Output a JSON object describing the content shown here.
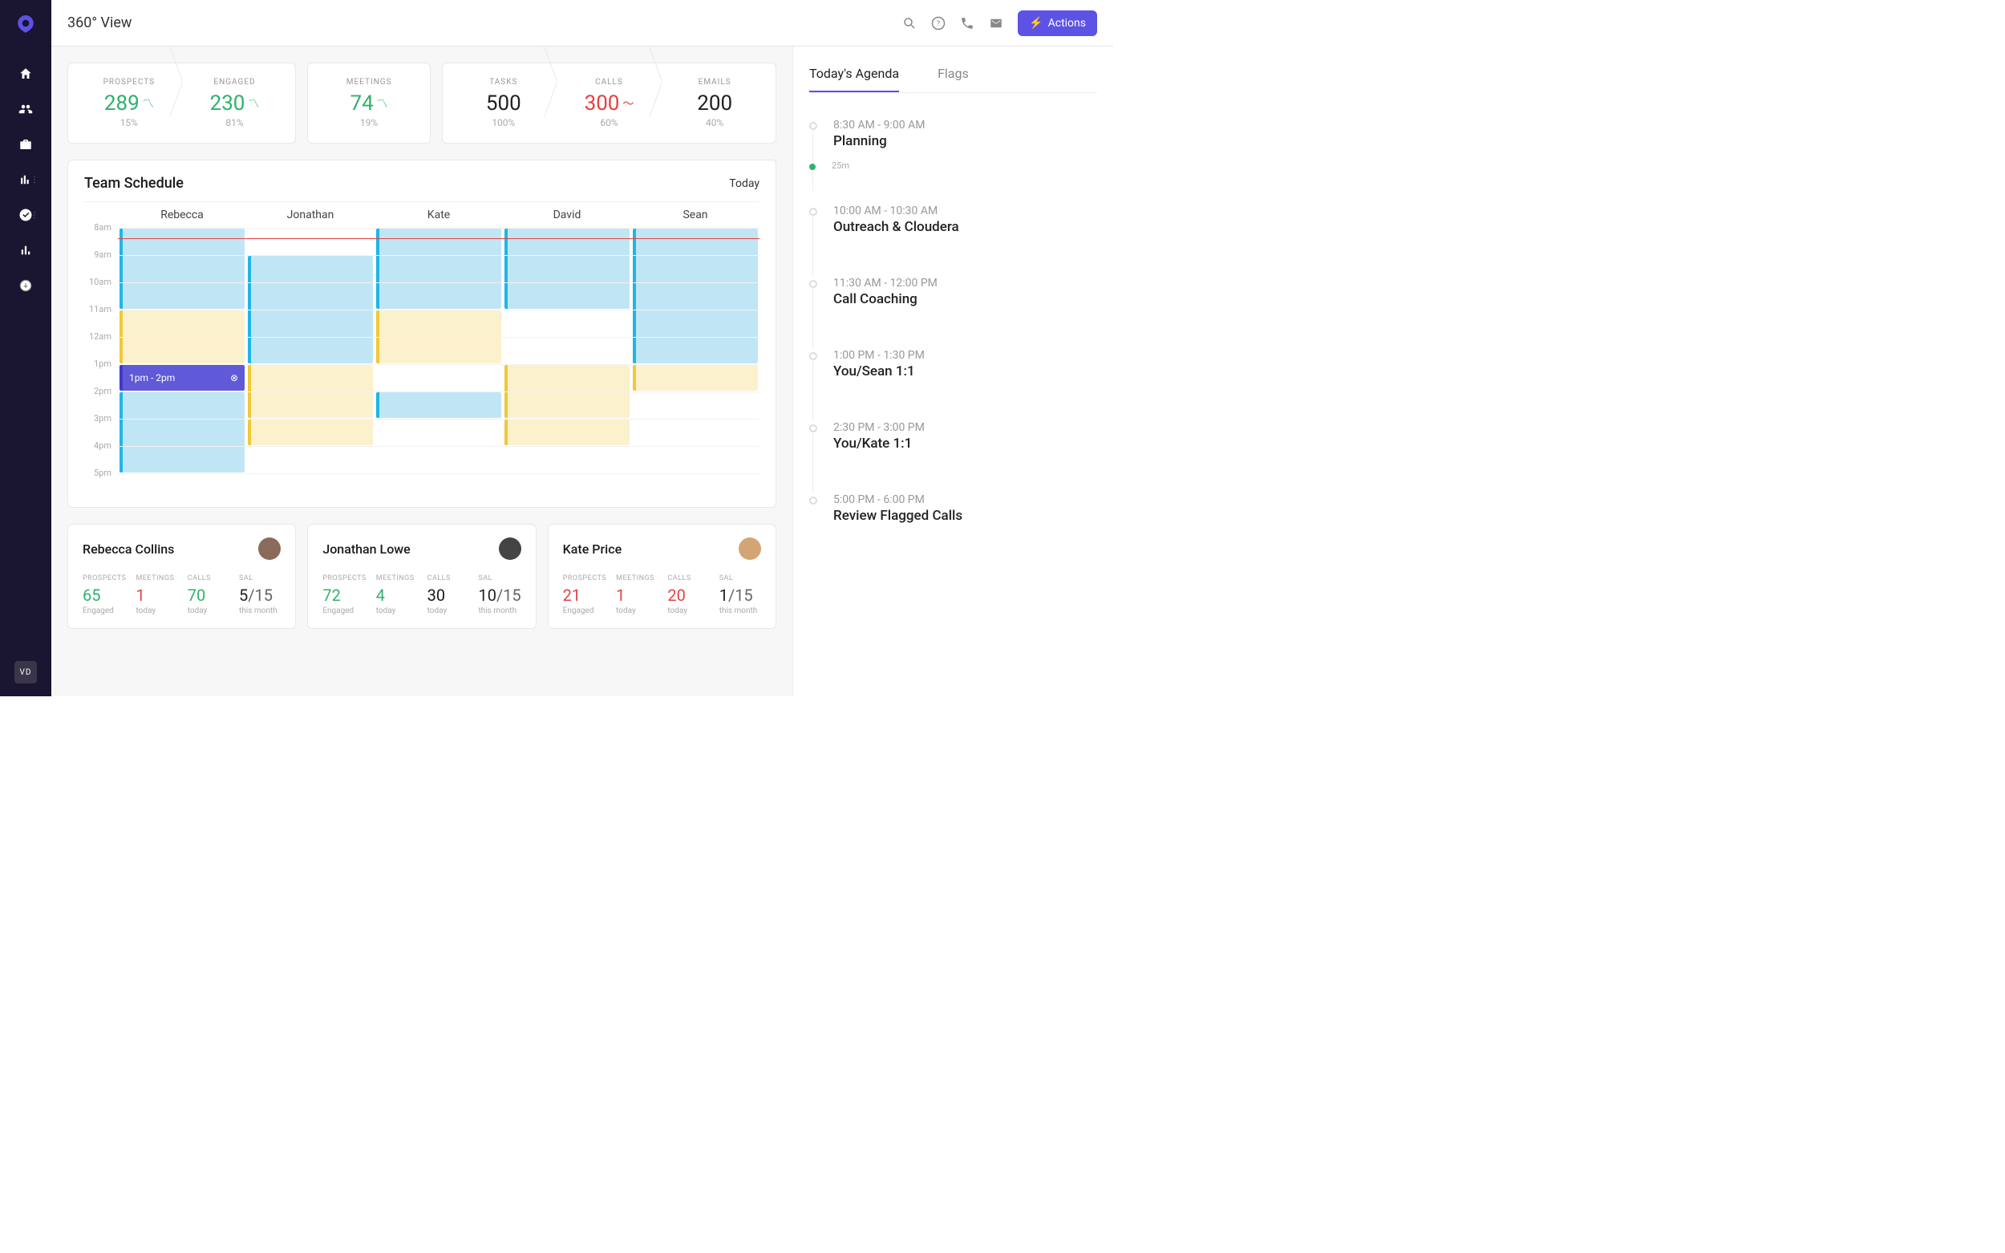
{
  "page_title": "360° View",
  "actions_label": "Actions",
  "sidebar": {
    "avatar_initials": "VD"
  },
  "stats": [
    {
      "label": "PROSPECTS",
      "value": "289",
      "pct": "15%",
      "trend": "up",
      "color": "green"
    },
    {
      "label": "ENGAGED",
      "value": "230",
      "pct": "81%",
      "trend": "up",
      "color": "green"
    },
    {
      "label": "MEETINGS",
      "value": "74",
      "pct": "19%",
      "trend": "up",
      "color": "green"
    },
    {
      "label": "TASKS",
      "value": "500",
      "pct": "100%",
      "trend": "",
      "color": ""
    },
    {
      "label": "CALLS",
      "value": "300",
      "pct": "60%",
      "trend": "down",
      "color": "red"
    },
    {
      "label": "EMAILS",
      "value": "200",
      "pct": "40%",
      "trend": "",
      "color": ""
    }
  ],
  "schedule": {
    "title": "Team Schedule",
    "today_label": "Today",
    "people": [
      "Rebecca",
      "Jonathan",
      "Kate",
      "David",
      "Sean"
    ],
    "hours": [
      "8am",
      "9am",
      "10am",
      "11am",
      "12am",
      "1pm",
      "2pm",
      "3pm",
      "4pm",
      "5pm"
    ],
    "highlight_label": "1pm - 2pm"
  },
  "agenda": {
    "tabs": [
      "Today's Agenda",
      "Flags"
    ],
    "now_label": "25m",
    "items": [
      {
        "time": "8:30 AM - 9:00 AM",
        "title": "Planning"
      },
      {
        "time": "10:00 AM - 10:30 AM",
        "title": "Outreach & Cloudera"
      },
      {
        "time": "11:30 AM - 12:00 PM",
        "title": "Call Coaching"
      },
      {
        "time": "1:00 PM - 1:30 PM",
        "title": "You/Sean 1:1"
      },
      {
        "time": "2:30 PM - 3:00 PM",
        "title": "You/Kate 1:1"
      },
      {
        "time": "5:00 PM - 6:00 PM",
        "title": "Review Flagged Calls"
      }
    ]
  },
  "people": [
    {
      "name": "Rebecca Collins",
      "stats": [
        {
          "label": "PROSPECTS",
          "value": "65",
          "sub": "Engaged",
          "color": "green"
        },
        {
          "label": "MEETINGS",
          "value": "1",
          "sub": "today",
          "color": "red"
        },
        {
          "label": "CALLS",
          "value": "70",
          "sub": "today",
          "color": "green"
        },
        {
          "label": "SAL",
          "value": "5/15",
          "sub": "this month",
          "color": ""
        }
      ]
    },
    {
      "name": "Jonathan Lowe",
      "stats": [
        {
          "label": "PROSPECTS",
          "value": "72",
          "sub": "Engaged",
          "color": "green"
        },
        {
          "label": "MEETINGS",
          "value": "4",
          "sub": "today",
          "color": "green"
        },
        {
          "label": "CALLS",
          "value": "30",
          "sub": "today",
          "color": ""
        },
        {
          "label": "SAL",
          "value": "10/15",
          "sub": "this month",
          "color": ""
        }
      ]
    },
    {
      "name": "Kate Price",
      "stats": [
        {
          "label": "PROSPECTS",
          "value": "21",
          "sub": "Engaged",
          "color": "red"
        },
        {
          "label": "MEETINGS",
          "value": "1",
          "sub": "today",
          "color": "red"
        },
        {
          "label": "CALLS",
          "value": "20",
          "sub": "today",
          "color": "red"
        },
        {
          "label": "SAL",
          "value": "1/15",
          "sub": "this month",
          "color": ""
        }
      ]
    }
  ]
}
